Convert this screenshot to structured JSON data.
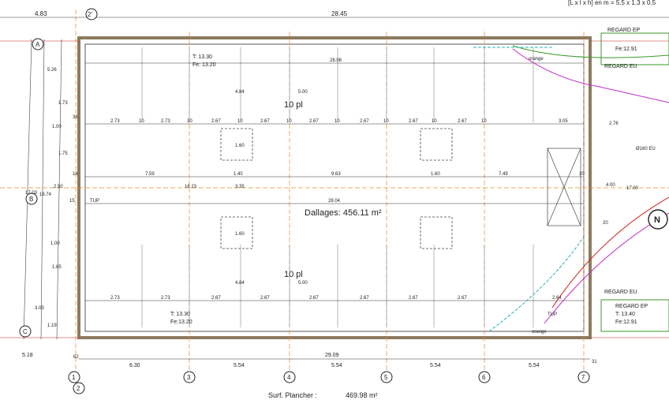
{
  "title_bar": {
    "bay_note": "[L x l x h] en m = 5.5 x 1.3 x 0.5",
    "total_width": "28.45",
    "left_offset": "4.83"
  },
  "areas": {
    "dallage": "Dallages: 456.11 m²",
    "parking_top": "10 pl",
    "parking_bottom": "10 pl",
    "floor_label": "Surf. Plancher :",
    "floor_value": "469.98 m²"
  },
  "grid_axes": {
    "vertical": [
      "1",
      "2",
      "3",
      "4",
      "5",
      "6",
      "7",
      "2'"
    ],
    "horizontal": [
      "A",
      "B",
      "C"
    ]
  },
  "bottom_dims": {
    "overall": "29.09",
    "bays": [
      "6.30",
      "5.54",
      "5.54",
      "5.54",
      "5.54"
    ],
    "small": [
      "62",
      "31"
    ],
    "left_total": "5.18"
  },
  "left_dims": {
    "overall": "17.03",
    "sub": "16.74",
    "segments": [
      "5.26",
      "1.73",
      "1.00",
      "1.75",
      "2.50",
      "1.00",
      "1.85",
      "3.03",
      "1.19",
      "36",
      "18",
      "15"
    ]
  },
  "right_dims": {
    "overall": "17.00",
    "segments": [
      "2.76",
      "4.00",
      "20",
      "20"
    ]
  },
  "interior": {
    "spacing_top": [
      "2.73",
      "10",
      "2.73",
      "10",
      "2.67",
      "10",
      "2.67",
      "10",
      "2.67",
      "10",
      "2.67",
      "10",
      "2.67",
      "10",
      "2.67",
      "10",
      "3.05"
    ],
    "spacing_bottom": [
      "2.73",
      "2.73",
      "2.67",
      "2.67",
      "2.67",
      "2.67",
      "2.67",
      "2.67",
      "2.64"
    ],
    "mid_row": [
      "7.59",
      "1.40",
      "9.63",
      "1.60",
      "7.49"
    ],
    "interior_width": "28.04",
    "interior_width_top": "28.08",
    "col_heights": [
      "16.23",
      "3.35",
      "4.84",
      "4.84",
      "5.00",
      "5.00",
      "1.60",
      "1.60"
    ]
  },
  "levels": {
    "tl": "T: 13.30",
    "tl2": "Fe: 13.20",
    "bl": "T: 13.30",
    "bl2": "Fe:13.20"
  },
  "regards": {
    "ep_top": "REGARD EP",
    "ep_top_fe": "Fe:12.91",
    "eu_top": "REGARD EU",
    "eu_bottom": "REGARD EU",
    "ep_bottom": "REGARD EP",
    "ep_bottom_t": "T: 13.40",
    "ep_bottom_fe": "Fe:12.91",
    "orange_labels": [
      "orange",
      "orange"
    ],
    "pipe": "Ø160 EU"
  },
  "misc": {
    "tup": "TUP",
    "tup2": "TUP",
    "north": "N"
  },
  "colors": {
    "wall": "#8d7a5e",
    "grid": "#e98a2a",
    "line": "#333333",
    "magenta": "#c02ac8",
    "green": "#3a9a2a",
    "red": "#d02020",
    "cyan": "#2ab0b8"
  }
}
